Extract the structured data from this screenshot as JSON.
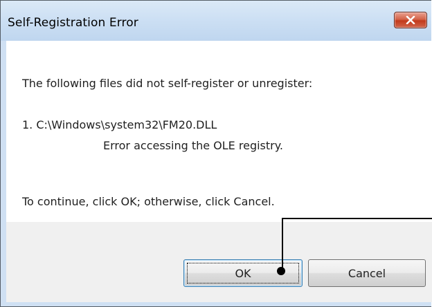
{
  "dialog": {
    "title": "Self-Registration Error",
    "close_icon": "close-icon",
    "message": {
      "intro": "The following files did not self-register or unregister:",
      "file_line": "1. C:\\Windows\\system32\\FM20.DLL",
      "error_line": "Error accessing the OLE registry.",
      "instruction": "To continue, click OK; otherwise, click Cancel."
    },
    "buttons": {
      "ok_label": "OK",
      "cancel_label": "Cancel"
    }
  },
  "colors": {
    "titlebar": "#cde0f4",
    "close_button": "#c23b1c",
    "footer": "#f0f0f0",
    "client": "#ffffff"
  }
}
